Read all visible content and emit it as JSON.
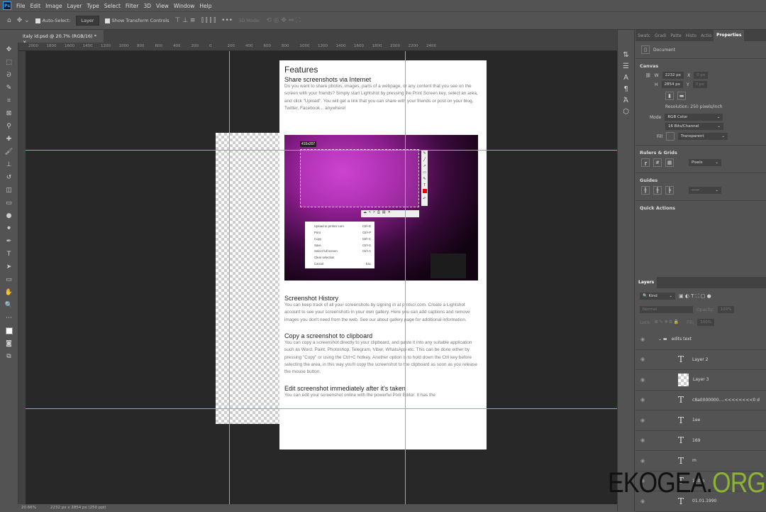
{
  "menubar": {
    "app_icon": "Ps",
    "items": [
      "File",
      "Edit",
      "Image",
      "Layer",
      "Type",
      "Select",
      "Filter",
      "3D",
      "View",
      "Window",
      "Help"
    ]
  },
  "options": {
    "auto_select_label": "Auto-Select:",
    "auto_select_value": "Layer",
    "show_transform_label": "Show Transform Controls",
    "more": "•••",
    "mode_3d": "3D Mode:"
  },
  "tab": {
    "title": "Italy id.psd @ 20.7% (RGB/16) *",
    "close": "×"
  },
  "ruler_ticks": [
    "2000",
    "1800",
    "1600",
    "1400",
    "1200",
    "1000",
    "800",
    "600",
    "400",
    "200",
    "0",
    "200",
    "400",
    "600",
    "800",
    "1000",
    "1200",
    "1400",
    "1600",
    "1800",
    "2000",
    "2200",
    "2400"
  ],
  "document": {
    "h1": "Features",
    "s1_title": "Share screenshots via Internet",
    "s1_body": "Do you want to share photos, images, parts of a webpage, or any content that you see on the screen with your friends? Simply start Lightshot by pressing the Print Screen key, select an area, and click \"Upload\". You will get a link that you can share with your friends or post on your blog, Twitter, Facebook... anywhere!",
    "shot": {
      "dimension": "415x207",
      "menu": [
        [
          "Upload to prntscr.com",
          "Ctrl+D"
        ],
        [
          "Print",
          "Ctrl+P"
        ],
        [
          "Copy",
          "Ctrl+C"
        ],
        [
          "Save",
          "Ctrl+S"
        ],
        [
          "Select full screen",
          "Ctrl+A"
        ],
        [
          "Clear selection",
          ""
        ],
        [
          "Cancel",
          "Esc"
        ]
      ]
    },
    "s2_title": "Screenshot History",
    "s2_body": "You can keep track of all your screenshots by signing in at prntscr.com. Create a Lightshot account to see your screenshots in your own gallery. Here you can add captions and remove images you don't need from the web. See our about gallery page for additional information.",
    "s3_title": "Copy a screenshot to clipboard",
    "s3_body": "You can copy a screenshot directly to your clipboard, and paste it into any suitable application such as Word, Paint, Photoshop, Telegram, Viber, WhatsApp etc. This can be done either by pressing \"Copy\" or using the Ctrl+C hotkey. Another option is to hold down the Ctrl key before selecting the area, in this way you'll copy the screenshot to the clipboard as soon as you release the mouse button.",
    "s4_title": "Edit screenshot immediately after it's taken",
    "s4_body": "You can edit your screenshot online with the powerful Pixlr Editor. It has the"
  },
  "status": {
    "zoom": "20.66%",
    "info": "2232 px x 2854 px (250 ppi)"
  },
  "properties": {
    "tabs": [
      "Swatc",
      "Gradi",
      "Patte",
      "Histo",
      "Actio",
      "Properties"
    ],
    "doc_label": "Document",
    "canvas_title": "Canvas",
    "w_label": "W",
    "w_value": "2232 px",
    "h_label": "H",
    "h_value": "2854 px",
    "x_label": "X",
    "x_value": "0 px",
    "y_label": "Y",
    "y_value": "0 px",
    "resolution": "Resolution: 250 pixels/inch",
    "mode_label": "Mode",
    "mode_value": "RGB Color",
    "depth_value": "16 Bits/Channel",
    "fill_label": "Fill",
    "fill_value": "Transparent",
    "rulers_title": "Rulers & Grids",
    "units_value": "Pixels",
    "guides_title": "Guides",
    "quick_title": "Quick Actions"
  },
  "layers": {
    "title": "Layers",
    "kind": "Kind",
    "blend": "Normal",
    "opacity_label": "Opacity:",
    "opacity": "100%",
    "lock_label": "Lock:",
    "fill_label": "Fill:",
    "fill": "100%",
    "group": "edits text",
    "items": [
      {
        "type": "text",
        "name": "Layer 2"
      },
      {
        "type": "image",
        "name": "Layer 3"
      },
      {
        "type": "text",
        "name": "c8a0000000....<<<<<<<<0 d"
      },
      {
        "type": "text",
        "name": "1ee"
      },
      {
        "type": "text",
        "name": "169"
      },
      {
        "type": "text",
        "name": "m"
      },
      {
        "type": "text",
        "name": "120 n"
      },
      {
        "type": "text",
        "name": "01.01.1990"
      }
    ]
  },
  "watermark": {
    "a": "EKOGEA.",
    "b": "ORG"
  },
  "colors": {
    "guide": "#4fc8d6",
    "canvas_bg": "#282828",
    "panel": "#535353",
    "accent_org": "#8cb432"
  }
}
